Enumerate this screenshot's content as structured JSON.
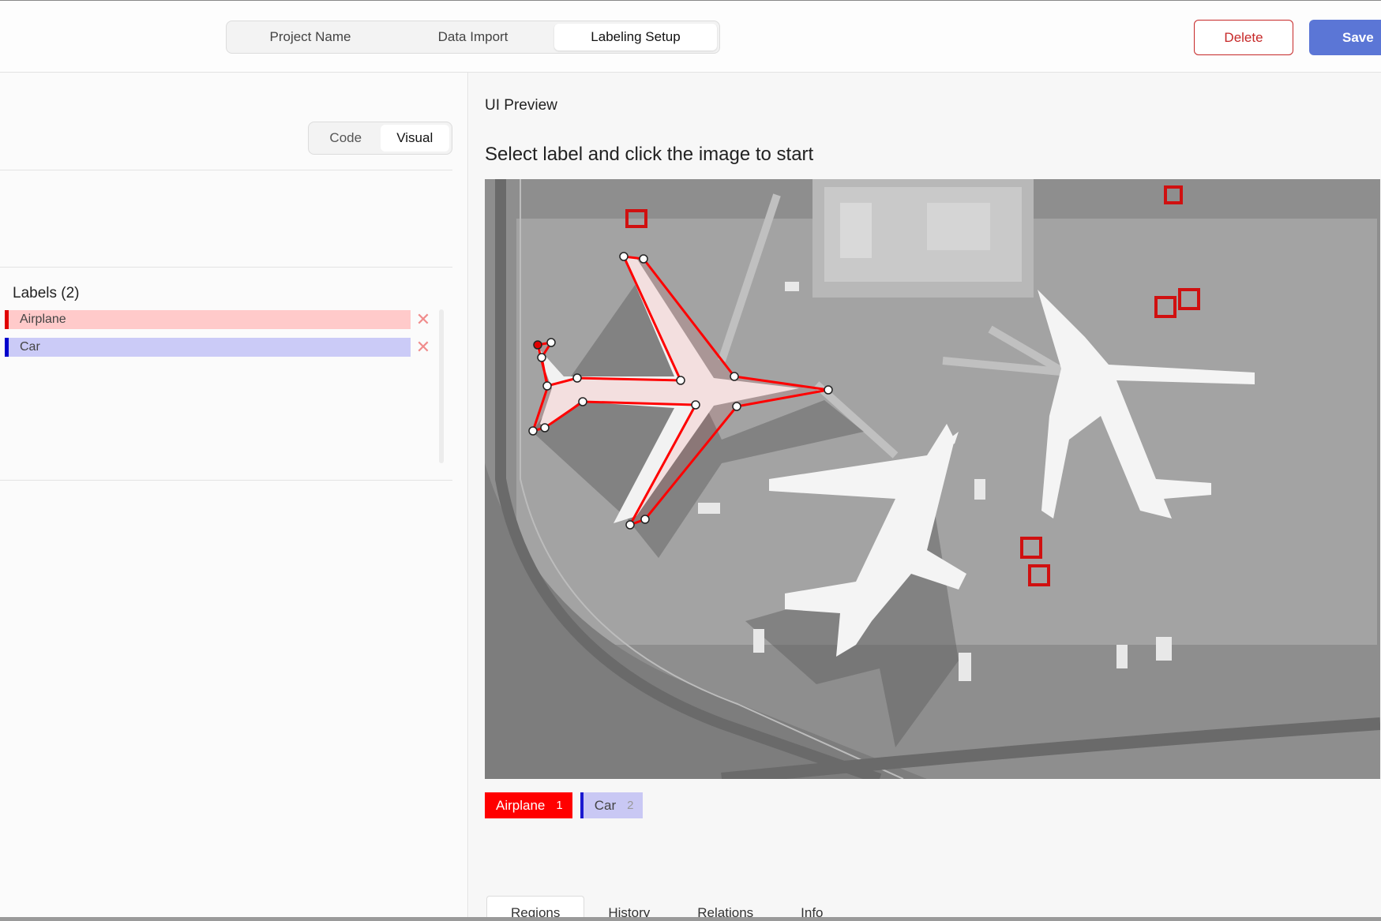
{
  "header": {
    "steps": [
      "Project Name",
      "Data Import",
      "Labeling Setup"
    ],
    "active_step": "Labeling Setup",
    "delete_label": "Delete",
    "save_label": "Save"
  },
  "config": {
    "modes": [
      "Code",
      "Visual"
    ],
    "active_mode": "Visual",
    "labels_title": "Labels (2)",
    "labels": [
      {
        "name": "Airplane",
        "bg": "#ffcaca",
        "border": "#e00000"
      },
      {
        "name": "Car",
        "bg": "#cbcbf7",
        "border": "#0000cc"
      }
    ],
    "remove_icon": "close-icon"
  },
  "preview": {
    "title": "UI Preview",
    "instruction": "Select label and click the image to start",
    "image_description_icon": "airport-aerial-photo",
    "region_tags": [
      {
        "name": "Airplane",
        "hotkey": "1",
        "color": "#ff0000"
      },
      {
        "name": "Car",
        "hotkey": "2",
        "color": "#1a1ad0"
      }
    ],
    "tabs": [
      "Regions",
      "History",
      "Relations",
      "Info"
    ],
    "active_tab": "Regions"
  }
}
